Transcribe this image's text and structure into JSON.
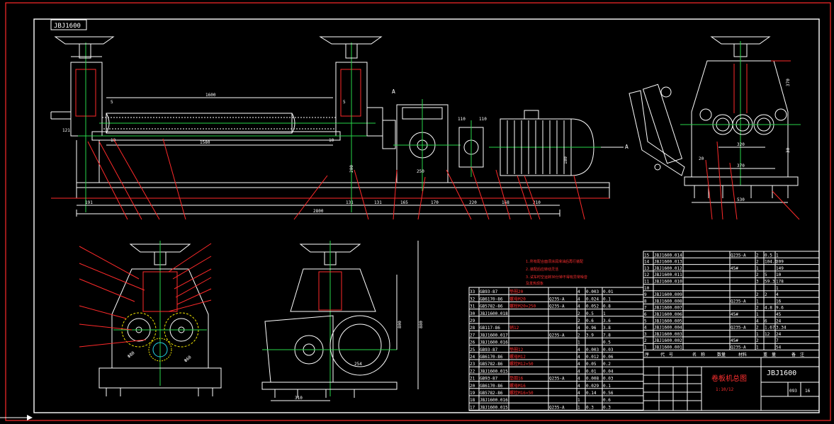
{
  "drawing": {
    "code_box": "JBJ1600",
    "main_title": "卷板机总图",
    "scale": "1:10/12",
    "drawing_no": "JBJ1600",
    "sheet_a": "093",
    "sheet_b": "16",
    "view_marker_a": "A",
    "view_marker_b": "A"
  },
  "dimensions": {
    "front": [
      "1600",
      "1580",
      "2800",
      "121",
      "131",
      "191",
      "131",
      "165",
      "170",
      "220",
      "168",
      "210",
      "5",
      "5",
      "10",
      "10",
      "250",
      "200",
      "110",
      "110",
      "180"
    ],
    "side": [
      "370",
      "320",
      "530",
      "370",
      "20",
      "30"
    ],
    "bottom_left": [
      "Φ80",
      "Φ60"
    ],
    "bottom_mid": [
      "310",
      "254",
      "800",
      "880"
    ]
  },
  "notes": [
    "1.所有配合面须涂润滑油后再行装配",
    "2.装配后应转动灵活",
    "3.试车时空运转30分钟不得有异常噪音",
    "  及发热现象"
  ],
  "parts_left": [
    [
      "33",
      "GB93-87",
      "垫圈20",
      "",
      "4",
      "0.003",
      "0.01"
    ],
    [
      "32",
      "GB6170-86",
      "螺母M20",
      "Q235-A",
      "4",
      "0.024",
      "0.1"
    ],
    [
      "31",
      "GB5782-86",
      "螺栓M20×250",
      "Q235-A",
      "4",
      "0.052",
      "0.8"
    ],
    [
      "30",
      "JBJ1600.018",
      "",
      "",
      "2",
      "0.5",
      "1"
    ],
    [
      "29",
      "",
      "",
      "",
      "2",
      "0.6",
      "3.6"
    ],
    [
      "28",
      "GB117-86",
      "销12",
      "",
      "4",
      "0.96",
      "3.8"
    ],
    [
      "27",
      "JBJ1600.017",
      "",
      "Q235-A",
      "2",
      "3.9",
      "7.8"
    ],
    [
      "26",
      "JBJ1600.016",
      "",
      "",
      "1",
      "",
      "0.5"
    ],
    [
      "25",
      "GB93-87",
      "垫圈12",
      "",
      "4",
      "0.003",
      "0.03"
    ],
    [
      "24",
      "GB6170-86",
      "螺母M12",
      "",
      "4",
      "0.012",
      "0.06"
    ],
    [
      "23",
      "GB5782-86",
      "螺栓M12×50",
      "",
      "4",
      "0.05",
      "0.2"
    ],
    [
      "22",
      "JBJ1600.015",
      "",
      "",
      "4",
      "0.01",
      "0.04"
    ],
    [
      "21",
      "GB93-87",
      "垫圈16",
      "Q235-A",
      "4",
      "0.008",
      "0.03"
    ],
    [
      "20",
      "GB6170-86",
      "螺母M16",
      "",
      "4",
      "0.029",
      "0.1"
    ],
    [
      "19",
      "GB5782-86",
      "螺栓M16×50",
      "",
      "4",
      "0.14",
      "0.56"
    ],
    [
      "18",
      "JBJ1600.016",
      "",
      "",
      "1",
      "",
      "0.6"
    ],
    [
      "17",
      "JBJ1600.015",
      "",
      "Q235-A",
      "1",
      "0.3",
      "0.3"
    ]
  ],
  "parts_right": [
    [
      "15",
      "JBJ1600.014",
      "",
      "Q235-A",
      "2",
      "0.5",
      "1"
    ],
    [
      "14",
      "JBJ1600.013",
      "",
      "",
      "2",
      "104.6",
      "209"
    ],
    [
      "13",
      "JBJ1600.012",
      "",
      "45#",
      "1",
      "",
      "149"
    ],
    [
      "12",
      "JBJ1600.011",
      "",
      "",
      "2",
      "5",
      "10"
    ],
    [
      "11",
      "JBJ1600.010",
      "",
      "",
      "3",
      "59.3",
      "178"
    ],
    [
      "10",
      "",
      "",
      "",
      "",
      "",
      "1"
    ],
    [
      "9",
      "JBJ1600.009",
      "",
      "",
      "2",
      "2",
      "4"
    ],
    [
      "8",
      "JBJ1600.008",
      "",
      "Q235-A",
      "1",
      "",
      "16"
    ],
    [
      "7",
      "JBJ1600.007",
      "",
      "",
      "2",
      "4.8",
      "9.6"
    ],
    [
      "6",
      "JBJ1600.006",
      "",
      "45#",
      "1",
      "",
      "45"
    ],
    [
      "5",
      "JBJ1600.005",
      "",
      "",
      "4",
      "6",
      "24"
    ],
    [
      "4",
      "JBJ1600.004",
      "",
      "Q235-A",
      "2",
      "1.67",
      "3.34"
    ],
    [
      "3",
      "JBJ1600.003",
      "",
      "",
      "1",
      "12",
      "24"
    ],
    [
      "2",
      "JBJ1600.002",
      "",
      "45#",
      "2",
      "",
      "7"
    ],
    [
      "1",
      "JBJ1600.001",
      "",
      "Q235-A",
      "1",
      "",
      "54"
    ]
  ],
  "parts_header": [
    "序号",
    "代号",
    "名称",
    "材料",
    "数量",
    "单重",
    "总重"
  ],
  "parts_footer": [
    "序",
    "代　号",
    "名　称",
    "数量",
    "材料",
    "重　量",
    "备　注"
  ]
}
